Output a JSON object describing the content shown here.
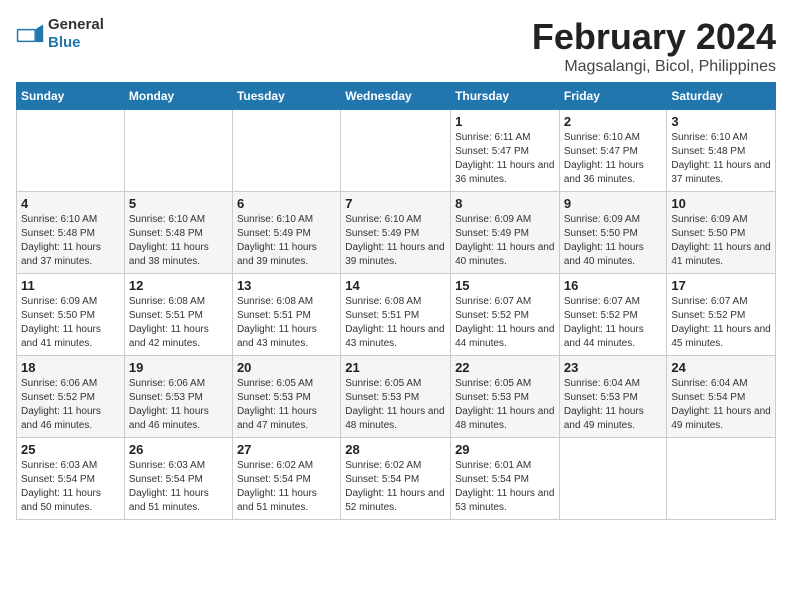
{
  "logo": {
    "text_general": "General",
    "text_blue": "Blue"
  },
  "title": "February 2024",
  "subtitle": "Magsalangi, Bicol, Philippines",
  "weekdays": [
    "Sunday",
    "Monday",
    "Tuesday",
    "Wednesday",
    "Thursday",
    "Friday",
    "Saturday"
  ],
  "weeks": [
    [
      {
        "day": "",
        "sunrise": "",
        "sunset": "",
        "daylight": ""
      },
      {
        "day": "",
        "sunrise": "",
        "sunset": "",
        "daylight": ""
      },
      {
        "day": "",
        "sunrise": "",
        "sunset": "",
        "daylight": ""
      },
      {
        "day": "",
        "sunrise": "",
        "sunset": "",
        "daylight": ""
      },
      {
        "day": "1",
        "sunrise": "Sunrise: 6:11 AM",
        "sunset": "Sunset: 5:47 PM",
        "daylight": "Daylight: 11 hours and 36 minutes."
      },
      {
        "day": "2",
        "sunrise": "Sunrise: 6:10 AM",
        "sunset": "Sunset: 5:47 PM",
        "daylight": "Daylight: 11 hours and 36 minutes."
      },
      {
        "day": "3",
        "sunrise": "Sunrise: 6:10 AM",
        "sunset": "Sunset: 5:48 PM",
        "daylight": "Daylight: 11 hours and 37 minutes."
      }
    ],
    [
      {
        "day": "4",
        "sunrise": "Sunrise: 6:10 AM",
        "sunset": "Sunset: 5:48 PM",
        "daylight": "Daylight: 11 hours and 37 minutes."
      },
      {
        "day": "5",
        "sunrise": "Sunrise: 6:10 AM",
        "sunset": "Sunset: 5:48 PM",
        "daylight": "Daylight: 11 hours and 38 minutes."
      },
      {
        "day": "6",
        "sunrise": "Sunrise: 6:10 AM",
        "sunset": "Sunset: 5:49 PM",
        "daylight": "Daylight: 11 hours and 39 minutes."
      },
      {
        "day": "7",
        "sunrise": "Sunrise: 6:10 AM",
        "sunset": "Sunset: 5:49 PM",
        "daylight": "Daylight: 11 hours and 39 minutes."
      },
      {
        "day": "8",
        "sunrise": "Sunrise: 6:09 AM",
        "sunset": "Sunset: 5:49 PM",
        "daylight": "Daylight: 11 hours and 40 minutes."
      },
      {
        "day": "9",
        "sunrise": "Sunrise: 6:09 AM",
        "sunset": "Sunset: 5:50 PM",
        "daylight": "Daylight: 11 hours and 40 minutes."
      },
      {
        "day": "10",
        "sunrise": "Sunrise: 6:09 AM",
        "sunset": "Sunset: 5:50 PM",
        "daylight": "Daylight: 11 hours and 41 minutes."
      }
    ],
    [
      {
        "day": "11",
        "sunrise": "Sunrise: 6:09 AM",
        "sunset": "Sunset: 5:50 PM",
        "daylight": "Daylight: 11 hours and 41 minutes."
      },
      {
        "day": "12",
        "sunrise": "Sunrise: 6:08 AM",
        "sunset": "Sunset: 5:51 PM",
        "daylight": "Daylight: 11 hours and 42 minutes."
      },
      {
        "day": "13",
        "sunrise": "Sunrise: 6:08 AM",
        "sunset": "Sunset: 5:51 PM",
        "daylight": "Daylight: 11 hours and 43 minutes."
      },
      {
        "day": "14",
        "sunrise": "Sunrise: 6:08 AM",
        "sunset": "Sunset: 5:51 PM",
        "daylight": "Daylight: 11 hours and 43 minutes."
      },
      {
        "day": "15",
        "sunrise": "Sunrise: 6:07 AM",
        "sunset": "Sunset: 5:52 PM",
        "daylight": "Daylight: 11 hours and 44 minutes."
      },
      {
        "day": "16",
        "sunrise": "Sunrise: 6:07 AM",
        "sunset": "Sunset: 5:52 PM",
        "daylight": "Daylight: 11 hours and 44 minutes."
      },
      {
        "day": "17",
        "sunrise": "Sunrise: 6:07 AM",
        "sunset": "Sunset: 5:52 PM",
        "daylight": "Daylight: 11 hours and 45 minutes."
      }
    ],
    [
      {
        "day": "18",
        "sunrise": "Sunrise: 6:06 AM",
        "sunset": "Sunset: 5:52 PM",
        "daylight": "Daylight: 11 hours and 46 minutes."
      },
      {
        "day": "19",
        "sunrise": "Sunrise: 6:06 AM",
        "sunset": "Sunset: 5:53 PM",
        "daylight": "Daylight: 11 hours and 46 minutes."
      },
      {
        "day": "20",
        "sunrise": "Sunrise: 6:05 AM",
        "sunset": "Sunset: 5:53 PM",
        "daylight": "Daylight: 11 hours and 47 minutes."
      },
      {
        "day": "21",
        "sunrise": "Sunrise: 6:05 AM",
        "sunset": "Sunset: 5:53 PM",
        "daylight": "Daylight: 11 hours and 48 minutes."
      },
      {
        "day": "22",
        "sunrise": "Sunrise: 6:05 AM",
        "sunset": "Sunset: 5:53 PM",
        "daylight": "Daylight: 11 hours and 48 minutes."
      },
      {
        "day": "23",
        "sunrise": "Sunrise: 6:04 AM",
        "sunset": "Sunset: 5:53 PM",
        "daylight": "Daylight: 11 hours and 49 minutes."
      },
      {
        "day": "24",
        "sunrise": "Sunrise: 6:04 AM",
        "sunset": "Sunset: 5:54 PM",
        "daylight": "Daylight: 11 hours and 49 minutes."
      }
    ],
    [
      {
        "day": "25",
        "sunrise": "Sunrise: 6:03 AM",
        "sunset": "Sunset: 5:54 PM",
        "daylight": "Daylight: 11 hours and 50 minutes."
      },
      {
        "day": "26",
        "sunrise": "Sunrise: 6:03 AM",
        "sunset": "Sunset: 5:54 PM",
        "daylight": "Daylight: 11 hours and 51 minutes."
      },
      {
        "day": "27",
        "sunrise": "Sunrise: 6:02 AM",
        "sunset": "Sunset: 5:54 PM",
        "daylight": "Daylight: 11 hours and 51 minutes."
      },
      {
        "day": "28",
        "sunrise": "Sunrise: 6:02 AM",
        "sunset": "Sunset: 5:54 PM",
        "daylight": "Daylight: 11 hours and 52 minutes."
      },
      {
        "day": "29",
        "sunrise": "Sunrise: 6:01 AM",
        "sunset": "Sunset: 5:54 PM",
        "daylight": "Daylight: 11 hours and 53 minutes."
      },
      {
        "day": "",
        "sunrise": "",
        "sunset": "",
        "daylight": ""
      },
      {
        "day": "",
        "sunrise": "",
        "sunset": "",
        "daylight": ""
      }
    ]
  ]
}
